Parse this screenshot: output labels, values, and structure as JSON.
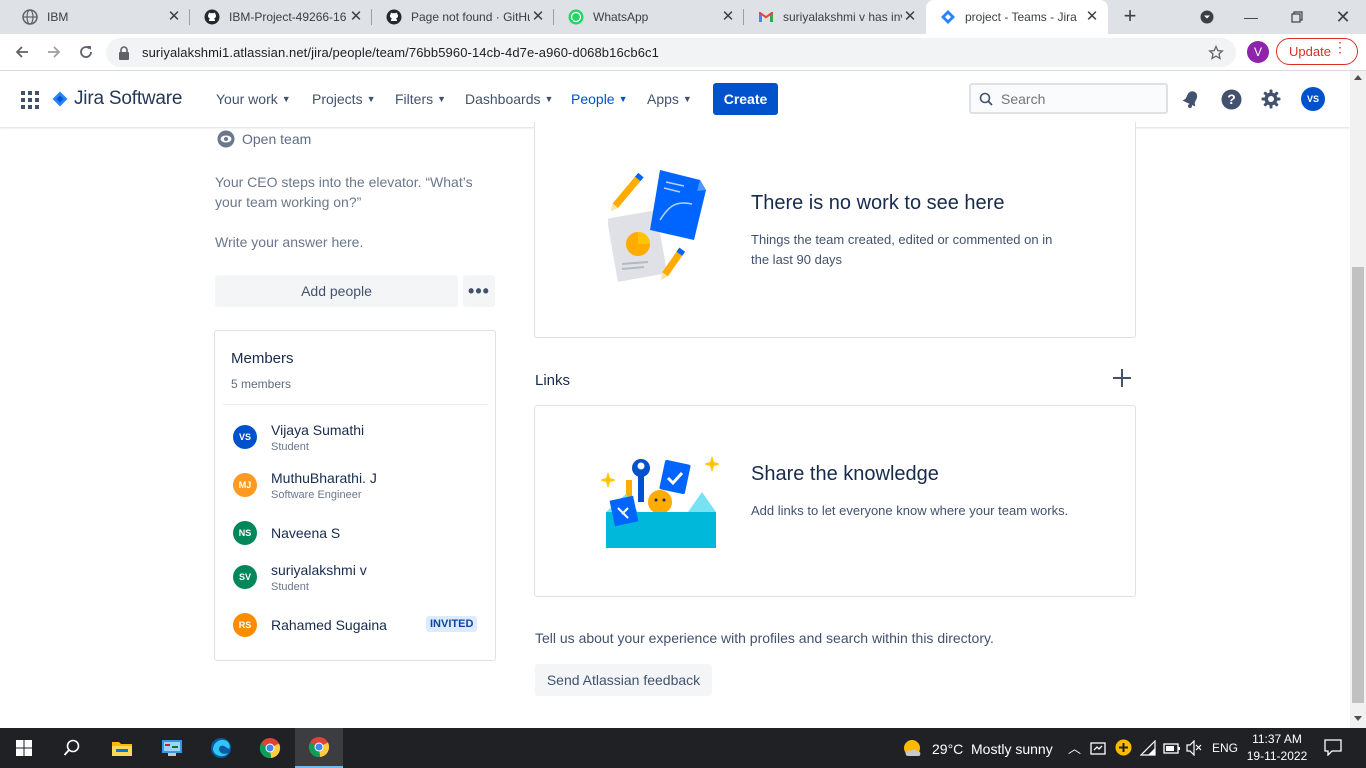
{
  "browser": {
    "tabs": [
      {
        "title": "IBM",
        "favicon": "globe-icon",
        "active": false
      },
      {
        "title": "IBM-Project-49266-16",
        "favicon": "github-icon",
        "active": false
      },
      {
        "title": "Page not found · GitHu",
        "favicon": "github-icon",
        "active": false
      },
      {
        "title": "WhatsApp",
        "favicon": "whatsapp-icon",
        "active": false
      },
      {
        "title": "suriyalakshmi v has inv",
        "favicon": "gmail-icon",
        "active": false
      },
      {
        "title": "project - Teams - Jira",
        "favicon": "jira-icon",
        "active": true
      }
    ],
    "url": "suriyalakshmi1.atlassian.net/jira/people/team/76bb5960-14cb-4d7e-a960-d068b16cb6c1",
    "profile_initial": "V",
    "update_label": "Update"
  },
  "header": {
    "product_name": "Jira Software",
    "nav": [
      {
        "label": "Your work"
      },
      {
        "label": "Projects"
      },
      {
        "label": "Filters"
      },
      {
        "label": "Dashboards"
      },
      {
        "label": "People",
        "active": true
      },
      {
        "label": "Apps"
      }
    ],
    "create_label": "Create",
    "search_placeholder": "Search",
    "avatar_initials": "VS"
  },
  "team": {
    "visibility": "Open team",
    "ceo_prompt": "Your CEO steps into the elevator. “What’s your team working on?”",
    "answer_placeholder": "Write your answer here.",
    "add_people_label": "Add people",
    "more_label": "•••"
  },
  "members": {
    "title": "Members",
    "count_label": "5 members",
    "items": [
      {
        "initials": "VS",
        "name": "Vijaya Sumathi",
        "role": "Student",
        "color": "#0052cc"
      },
      {
        "initials": "MJ",
        "name": "MuthuBharathi. J",
        "role": "Software Engineer",
        "color": "#ff991f"
      },
      {
        "initials": "NS",
        "name": "Naveena S",
        "role": "",
        "color": "#00875a"
      },
      {
        "initials": "SV",
        "name": "suriyalakshmi v",
        "role": "Student",
        "color": "#00875a"
      },
      {
        "initials": "RS",
        "name": "Rahamed Sugaina",
        "role": "",
        "color": "#ff8b00",
        "badge": "INVITED"
      }
    ]
  },
  "work": {
    "title": "There is no work to see here",
    "description": "Things the team created, edited or commented on in the last 90 days"
  },
  "links": {
    "title": "Links",
    "card_title": "Share the knowledge",
    "card_description": "Add links to let everyone know where your team works."
  },
  "feedback": {
    "text": "Tell us about your experience with profiles and search within this directory.",
    "button_label": "Send Atlassian feedback"
  },
  "taskbar": {
    "weather_temp": "29°C",
    "weather_desc": "Mostly sunny",
    "language": "ENG",
    "time": "11:37 AM",
    "date": "19-11-2022"
  },
  "colors": {
    "accent": "#0052cc",
    "text_primary": "#172b4d",
    "text_secondary": "#6b778c"
  }
}
